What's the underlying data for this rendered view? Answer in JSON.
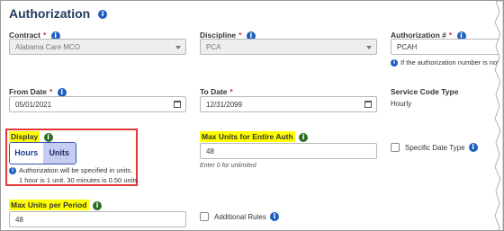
{
  "title": "Authorization",
  "fields": {
    "contract": {
      "label": "Contract",
      "value": "Alabama Care MCO"
    },
    "discipline": {
      "label": "Discipline",
      "value": "PCA"
    },
    "auth_number": {
      "label": "Authorization #",
      "value": "PCAH",
      "note": "If the authorization number is not"
    },
    "from_date": {
      "label": "From Date",
      "value": "05/01/2021"
    },
    "to_date": {
      "label": "To Date",
      "value": "12/31/2099"
    },
    "service_code_type": {
      "label": "Service Code Type",
      "value": "Hourly"
    },
    "display": {
      "label": "Display",
      "options": [
        "Hours",
        "Units"
      ],
      "selected": "Units",
      "note_line1": "Authorization will be specified in units.",
      "note_line2": "1 hour is 1 unit. 30 minutes is 0.50 units."
    },
    "max_units_entire": {
      "label": "Max Units for Entire Auth",
      "value": "48",
      "hint": "Enter 0 for unlimited"
    },
    "specific_date_type": {
      "label": "Specific Date Type"
    },
    "max_units_period": {
      "label": "Max Units per Period",
      "value": "48"
    },
    "additional_rules": {
      "label": "Additional Rules"
    }
  },
  "colors": {
    "highlight": "#ffff00",
    "callout_border": "#e53935",
    "info": "#1f5fbf",
    "toggle_active": "#c5cef0"
  }
}
